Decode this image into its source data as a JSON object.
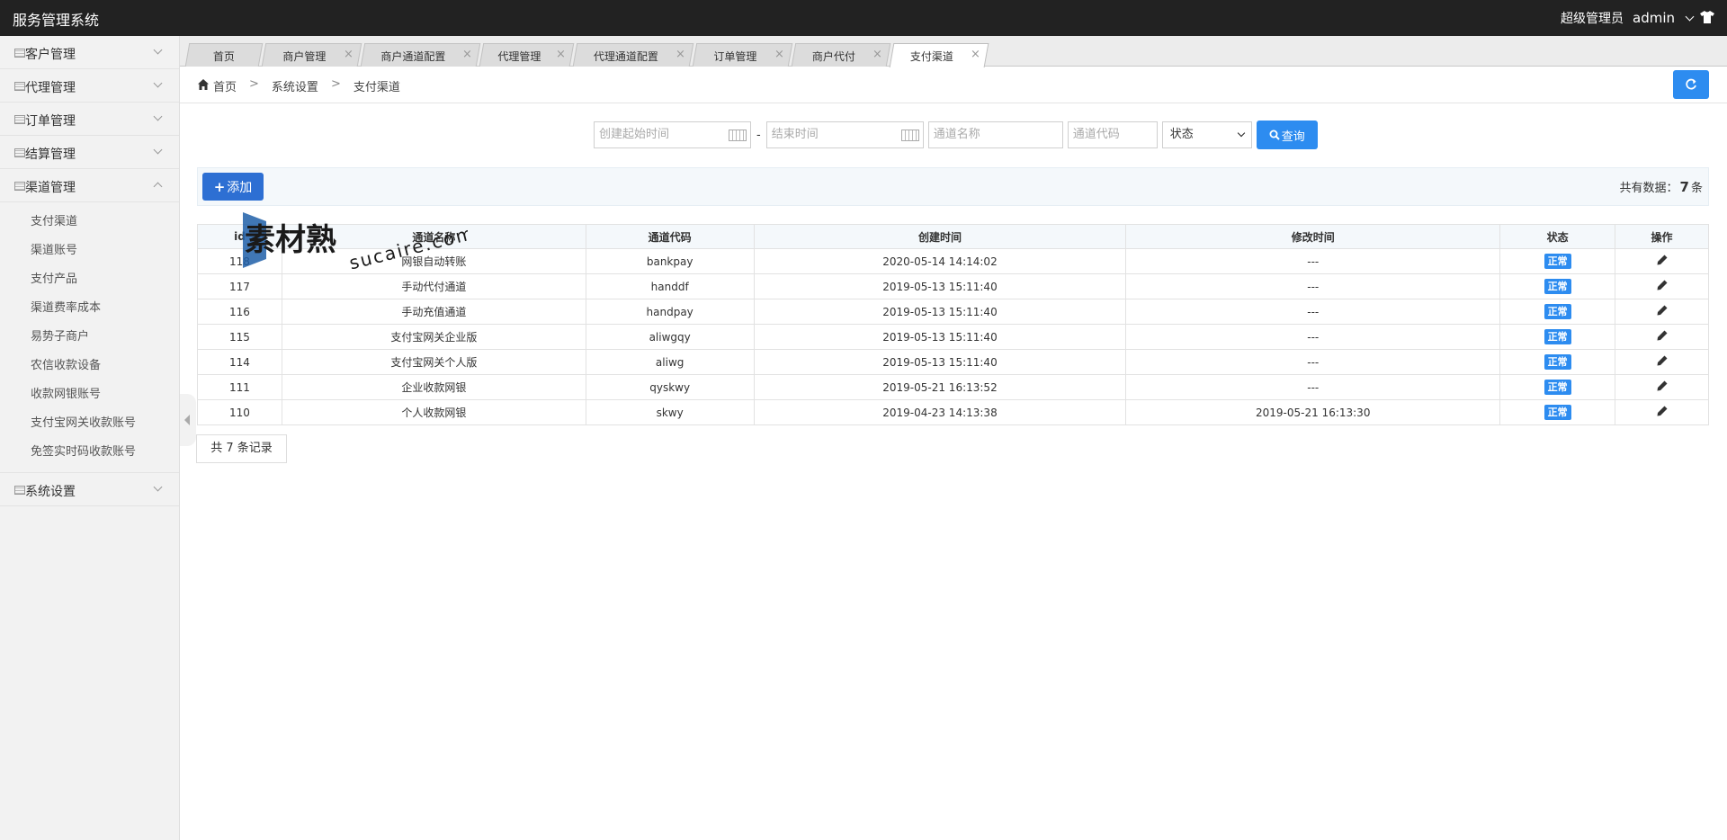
{
  "app": {
    "title": "服务管理系统"
  },
  "user": {
    "role": "超级管理员",
    "name": "admin"
  },
  "sidebar": {
    "groups": [
      {
        "label": "客户管理",
        "open": false
      },
      {
        "label": "代理管理",
        "open": false
      },
      {
        "label": "订单管理",
        "open": false
      },
      {
        "label": "结算管理",
        "open": false
      },
      {
        "label": "渠道管理",
        "open": true
      },
      {
        "label": "系统设置",
        "open": false
      }
    ],
    "channel_items": [
      "支付渠道",
      "渠道账号",
      "支付产品",
      "渠道费率成本",
      "易势子商户",
      "农信收款设备",
      "收款网银账号",
      "支付宝网关收款账号",
      "免签实时码收款账号"
    ]
  },
  "tabs": [
    {
      "label": "首页",
      "active": false
    },
    {
      "label": "商户管理",
      "active": false
    },
    {
      "label": "商户通道配置",
      "active": false
    },
    {
      "label": "代理管理",
      "active": false
    },
    {
      "label": "代理通道配置",
      "active": false
    },
    {
      "label": "订单管理",
      "active": false
    },
    {
      "label": "商户代付",
      "active": false
    },
    {
      "label": "支付渠道",
      "active": true
    }
  ],
  "tab_close_glyph": "×",
  "breadcrumb": {
    "home": "首页",
    "sep": ">",
    "level1": "系统设置",
    "level2": "支付渠道"
  },
  "filters": {
    "start_placeholder": "创建起始时间",
    "dash": "-",
    "end_placeholder": "结束时间",
    "name_placeholder": "通道名称",
    "code_placeholder": "通道代码",
    "status_value": "状态",
    "query_label": "查询"
  },
  "toolbar": {
    "add_label": "添加",
    "add_plus": "+",
    "total_prefix": "共有数据：",
    "total_count": "7",
    "total_suffix": "条"
  },
  "table": {
    "headers": [
      "id",
      "通道名称",
      "通道代码",
      "创建时间",
      "修改时间",
      "状态",
      "操作"
    ],
    "rows": [
      {
        "id": "118",
        "name": "网银自动转账",
        "code": "bankpay",
        "created": "2020-05-14 14:14:02",
        "modified": "---",
        "status": "正常"
      },
      {
        "id": "117",
        "name": "手动代付通道",
        "code": "handdf",
        "created": "2019-05-13 15:11:40",
        "modified": "---",
        "status": "正常"
      },
      {
        "id": "116",
        "name": "手动充值通道",
        "code": "handpay",
        "created": "2019-05-13 15:11:40",
        "modified": "---",
        "status": "正常"
      },
      {
        "id": "115",
        "name": "支付宝网关企业版",
        "code": "aliwgqy",
        "created": "2019-05-13 15:11:40",
        "modified": "---",
        "status": "正常"
      },
      {
        "id": "114",
        "name": "支付宝网关个人版",
        "code": "aliwg",
        "created": "2019-05-13 15:11:40",
        "modified": "---",
        "status": "正常"
      },
      {
        "id": "111",
        "name": "企业收款网银",
        "code": "qyskwy",
        "created": "2019-05-21 16:13:52",
        "modified": "---",
        "status": "正常"
      },
      {
        "id": "110",
        "name": "个人收款网银",
        "code": "skwy",
        "created": "2019-04-23 14:13:38",
        "modified": "2019-05-21 16:13:30",
        "status": "正常"
      }
    ]
  },
  "pager": {
    "records_label": "共 7 条记录"
  },
  "watermark": {
    "brand": "素材熟",
    "domain": "sucaire.com"
  },
  "colors": {
    "primary": "#2d8cf0",
    "add_button": "#2d6fd3",
    "topbar": "#222222",
    "sidebar": "#f2f2f2"
  }
}
